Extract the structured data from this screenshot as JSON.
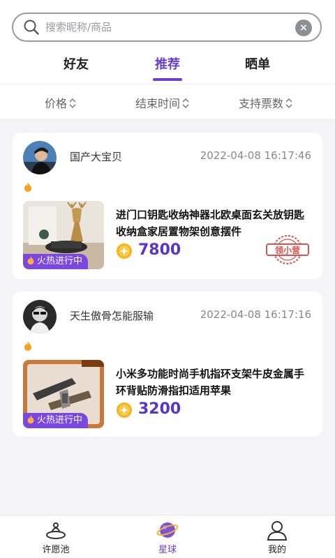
{
  "search": {
    "placeholder": "搜索昵称/商品"
  },
  "tabs": [
    {
      "label": "好友"
    },
    {
      "label": "推荐"
    },
    {
      "label": "晒单"
    }
  ],
  "active_tab": "推荐",
  "sort": [
    {
      "label": "价格"
    },
    {
      "label": "结束时间"
    },
    {
      "label": "支持票数"
    }
  ],
  "posts": [
    {
      "user": "国产大宝贝",
      "time": "2022-04-08 16:17:46",
      "title": "进门口钥匙收纳神器北欧桌面玄关放钥匙收纳盒家居置物架创意摆件",
      "price": "7800",
      "badge": "火热进行中",
      "stamp": "领小营"
    },
    {
      "user": "天生傲骨怎能服输",
      "time": "2022-04-08 16:17:16",
      "title": "小米多功能时尚手机指环支架牛皮金属手环背贴防滑指扣适用苹果",
      "price": "3200",
      "badge": "火热进行中"
    }
  ],
  "bottom_nav": [
    {
      "label": "许愿池",
      "icon": "wish-pool-icon"
    },
    {
      "label": "星球",
      "icon": "planet-icon"
    },
    {
      "label": "我的",
      "icon": "user-icon"
    }
  ],
  "colors": {
    "accent": "#6a3fd6",
    "price": "#5b34c9",
    "badge": "#7b47e0",
    "coin": "#f2b51b"
  }
}
